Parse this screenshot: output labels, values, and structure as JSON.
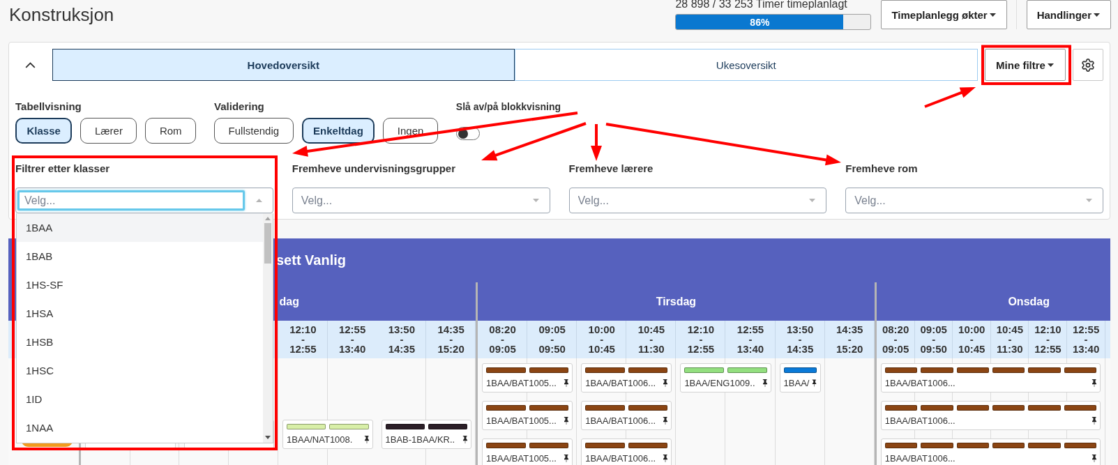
{
  "page": {
    "title": "Konstruksjon"
  },
  "progress": {
    "caption": "28 898 / 33 253 Timer timeplanlagt",
    "level": 0.86,
    "reading": "86%"
  },
  "header_buttons": [
    {
      "label": "Timeplanlegg økter"
    },
    {
      "label": "Handlinger"
    }
  ],
  "panel": {
    "expanded": true,
    "tabs": [
      {
        "label": "Hovedoversikt",
        "selected": true
      },
      {
        "label": "Ukesoversikt",
        "selected": false
      }
    ],
    "filter_menu": {
      "label": "Mine filtre"
    },
    "option_groups": [
      {
        "label": "Tabellvisning",
        "options": [
          {
            "label": "Klasse",
            "selected": true
          },
          {
            "label": "Lærer",
            "selected": false
          },
          {
            "label": "Rom",
            "selected": false
          }
        ]
      },
      {
        "label": "Validering",
        "options": [
          {
            "label": "Fullstendig",
            "selected": false
          },
          {
            "label": "Enkeltdag",
            "selected": true
          },
          {
            "label": "Ingen",
            "selected": false
          }
        ]
      }
    ],
    "block_view": {
      "label": "Slå av/på blokkvisning",
      "on": false
    },
    "filters": [
      {
        "label": "Filtrer etter klasser",
        "placeholder": "Velg...",
        "focused": true,
        "open": true,
        "options": [
          {
            "label": "1BAA",
            "highlighted": true
          },
          {
            "label": "1BAB",
            "highlighted": false
          },
          {
            "label": "1HS-SF",
            "highlighted": false
          },
          {
            "label": "1HSA",
            "highlighted": false
          },
          {
            "label": "1HSB",
            "highlighted": false
          },
          {
            "label": "1HSC",
            "highlighted": false
          },
          {
            "label": "1ID",
            "highlighted": false
          },
          {
            "label": "1NAA",
            "highlighted": false
          }
        ]
      },
      {
        "label": "Fremheve undervisningsgrupper",
        "placeholder": "Velg...",
        "focused": false,
        "open": false
      },
      {
        "label": "Fremheve lærere",
        "placeholder": "Velg...",
        "focused": false,
        "open": false
      },
      {
        "label": "Fremheve rom",
        "placeholder": "Velg...",
        "focused": false,
        "open": false
      }
    ]
  },
  "schedule": {
    "title": "sett Vanlig",
    "row_header": {
      "badge": true
    },
    "days": [
      {
        "name": "dag",
        "covered": true,
        "times": [
          "12:10 - 12:55",
          "12:55 - 13:40",
          "13:50 - 14:35",
          "14:35 - 15:20"
        ],
        "rows": [
          {
            "kind": "blank"
          },
          {
            "kind": "cards",
            "cells": [
              {
                "kind": "covered"
              },
              {
                "kind": "covered"
              },
              {
                "kind": "card",
                "label": "1BAA/NAT1008.",
                "pinned": true,
                "bars": [
                  {
                    "color": "#d8efa8"
                  },
                  {
                    "color": "#d8efa8"
                  }
                ]
              },
              {
                "kind": "card",
                "label": "1BAB-1BAA/KR..",
                "pinned": true,
                "bars": [
                  {
                    "color": "#2b1f27"
                  },
                  {
                    "color": "#2b1f27"
                  }
                ]
              }
            ]
          }
        ]
      },
      {
        "name": "Tirsdag",
        "covered": false,
        "times": [
          "08:20 - 09:05",
          "09:05 - 09:50",
          "10:00 - 10:45",
          "10:45 - 11:30",
          "12:10 - 12:55",
          "12:55 - 13:40",
          "13:50 - 14:35",
          "14:35 - 15:20"
        ],
        "rows": [
          {
            "kind": "cards",
            "cells": [
              {
                "kind": "card",
                "label": "1BAA/BAT1005...",
                "pinned": true,
                "bars": [
                  {
                    "color": "#8b4513"
                  },
                  {
                    "color": "#8b4513"
                  }
                ]
              },
              {
                "kind": "card",
                "label": "1BAA/BAT1006...",
                "pinned": true,
                "bars": [
                  {
                    "color": "#8b4513"
                  },
                  {
                    "color": "#8b4513"
                  }
                ]
              },
              {
                "kind": "card",
                "label": "1BAA/ENG1009..",
                "pinned": true,
                "bars": [
                  {
                    "color": "#93df7f"
                  },
                  {
                    "color": "#93df7f"
                  }
                ]
              },
              {
                "kind": "card",
                "label": "1BAA/",
                "pinned": true,
                "bars": [
                  {
                    "color": "#0a7ad8"
                  }
                ]
              }
            ]
          },
          {
            "kind": "cards",
            "cells": [
              {
                "kind": "card",
                "label": "1BAA/BAT1005...",
                "pinned": true,
                "bars": [
                  {
                    "color": "#8b4513"
                  },
                  {
                    "color": "#8b4513"
                  }
                ]
              },
              {
                "kind": "card",
                "label": "1BAA/BAT1006...",
                "pinned": true,
                "bars": [
                  {
                    "color": "#8b4513"
                  },
                  {
                    "color": "#8b4513"
                  }
                ]
              }
            ]
          },
          {
            "kind": "cards",
            "cells": [
              {
                "kind": "card",
                "label": "1BAA/BAT1005...",
                "pinned": true,
                "bars": [
                  {
                    "color": "#8b4513"
                  },
                  {
                    "color": "#8b4513"
                  }
                ]
              },
              {
                "kind": "card",
                "label": "1BAA/BAT1006...",
                "pinned": true,
                "bars": [
                  {
                    "color": "#8b4513"
                  },
                  {
                    "color": "#8b4513"
                  }
                ]
              }
            ]
          }
        ]
      },
      {
        "name": "Onsdag",
        "covered": false,
        "times": [
          "08:20 - 09:05",
          "09:05 - 09:50",
          "10:00 - 10:45",
          "10:45 - 11:30",
          "12:10 - 12:55",
          "12:55 - 13:40"
        ],
        "rows": [
          {
            "kind": "cards",
            "cells": [
              {
                "kind": "card",
                "label": "1BAA/BAT1006...",
                "pinned": true,
                "bars": [
                  {
                    "color": "#8b4513"
                  },
                  {
                    "color": "#8b4513"
                  },
                  {
                    "color": "#8b4513"
                  },
                  {
                    "color": "#8b4513"
                  },
                  {
                    "color": "#8b4513"
                  },
                  {
                    "color": "#8b4513"
                  }
                ]
              }
            ]
          },
          {
            "kind": "cards",
            "cells": [
              {
                "kind": "card",
                "label": "1BAA/BAT1006...",
                "pinned": true,
                "bars": [
                  {
                    "color": "#8b4513"
                  },
                  {
                    "color": "#8b4513"
                  },
                  {
                    "color": "#8b4513"
                  },
                  {
                    "color": "#8b4513"
                  },
                  {
                    "color": "#8b4513"
                  },
                  {
                    "color": "#8b4513"
                  }
                ]
              }
            ]
          },
          {
            "kind": "cards",
            "cells": [
              {
                "kind": "card",
                "label": "1BAA/BAT1006...",
                "pinned": true,
                "bars": [
                  {
                    "color": "#8b4513"
                  },
                  {
                    "color": "#8b4513"
                  },
                  {
                    "color": "#8b4513"
                  },
                  {
                    "color": "#8b4513"
                  },
                  {
                    "color": "#8b4513"
                  },
                  {
                    "color": "#8b4513"
                  }
                ]
              }
            ]
          }
        ]
      }
    ]
  },
  "annotations": [
    {
      "kind": "frame"
    },
    {
      "kind": "frame"
    },
    {
      "kind": "arrow"
    },
    {
      "kind": "arrow"
    },
    {
      "kind": "arrow"
    },
    {
      "kind": "arrow"
    },
    {
      "kind": "arrow"
    }
  ]
}
